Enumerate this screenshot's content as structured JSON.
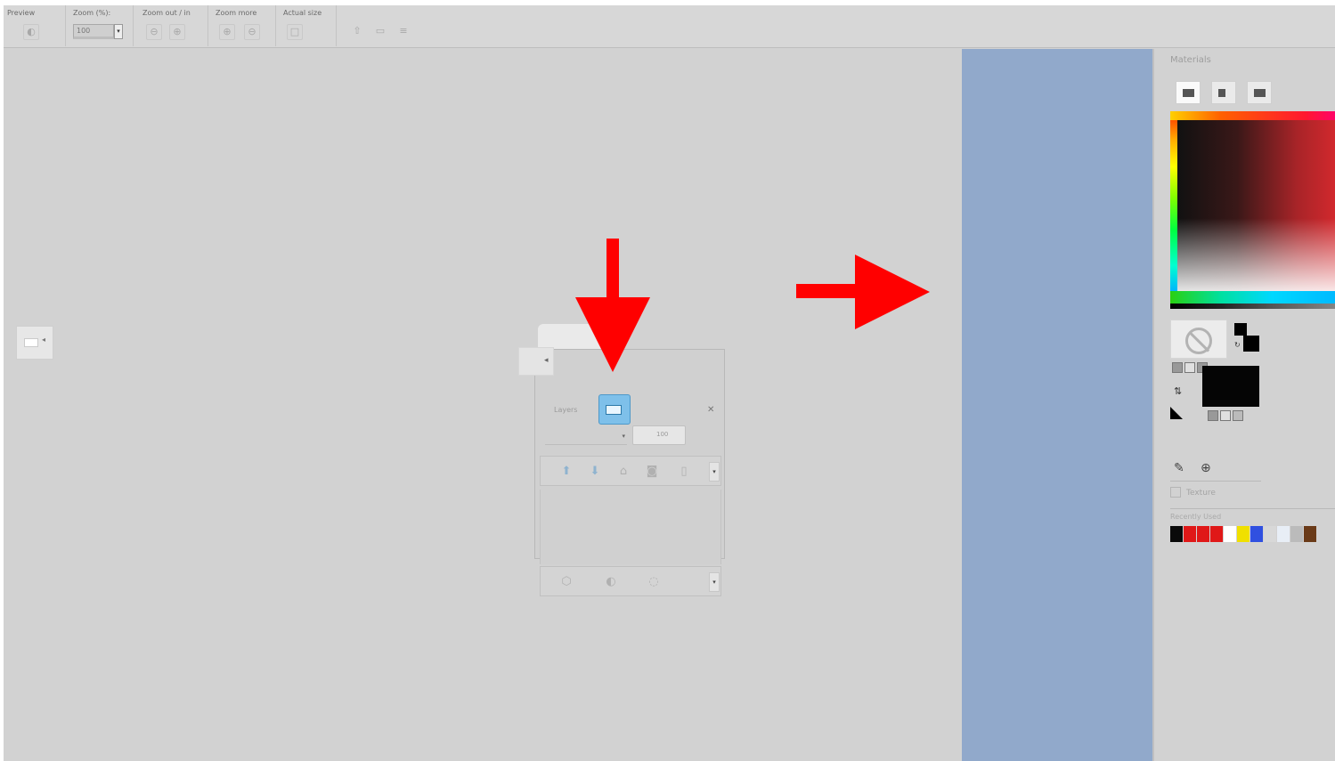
{
  "toolbar": {
    "groups": [
      {
        "label": "Preview"
      },
      {
        "label": "Zoom (%):"
      },
      {
        "label": "Zoom out / in"
      },
      {
        "label": "Zoom more"
      },
      {
        "label": "Actual size"
      }
    ],
    "zoom_value": "100"
  },
  "layers_palette": {
    "title": "Layers",
    "blend_label": "100"
  },
  "materials": {
    "title": "Materials",
    "textures_label": "Texture",
    "recent_label": "Recently Used",
    "recent_colors": [
      "#0a0a0a",
      "#e01818",
      "#e01818",
      "#e01818",
      "#ffffff",
      "#f0e000",
      "#3050e0",
      "#d8d8d8",
      "#e8eef6",
      "#bbbbbb",
      "#6a3a18"
    ]
  },
  "colors": {
    "workspace": "#d2d2d2",
    "canvas": "#91a9cb",
    "arrow": "#ff0000"
  },
  "icons": [
    "preview-icon",
    "zoom-out-icon",
    "zoom-in-icon",
    "zoom-more-icon",
    "actual-size-icon",
    "layers-icon",
    "dropper-icon",
    "crosshair-icon",
    "no-color-icon"
  ]
}
